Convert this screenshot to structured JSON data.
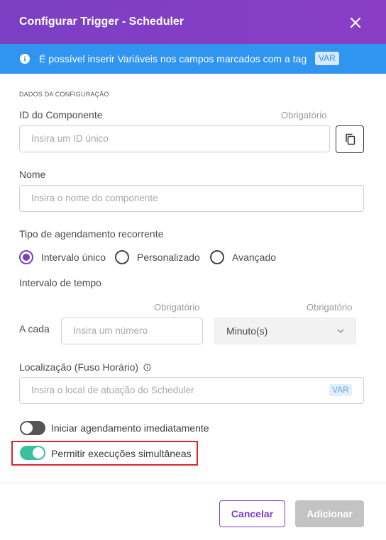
{
  "header": {
    "title": "Configurar Trigger - Scheduler",
    "close_icon": "close-icon"
  },
  "info_banner": {
    "icon": "info-icon",
    "text": "É possível inserir Variáveis nos campos marcados com a tag",
    "tag": "VAR"
  },
  "section": {
    "label": "DADOS DA CONFIGURAÇÃO"
  },
  "component_id": {
    "label": "ID do Componente",
    "required": "Obrigatório",
    "placeholder": "Insira um ID único",
    "copy_icon": "copy-icon"
  },
  "name": {
    "label": "Nome",
    "placeholder": "Insira o nome do componente"
  },
  "schedule_type": {
    "label": "Tipo de agendamento recorrente",
    "options": [
      {
        "label": "Intervalo único",
        "selected": true
      },
      {
        "label": "Personalizado",
        "selected": false
      },
      {
        "label": "Avançado",
        "selected": false
      }
    ]
  },
  "interval": {
    "label": "Intervalo de tempo",
    "every_label": "A cada",
    "number_required": "Obrigatório",
    "number_placeholder": "Insira um número",
    "unit_required": "Obrigatório",
    "unit_value": "Minuto(s)"
  },
  "location": {
    "label": "Localização (Fuso Horário)",
    "info_icon": "info-circle-icon",
    "placeholder": "Insira o local de atuação do Scheduler",
    "tag": "VAR"
  },
  "toggles": [
    {
      "label": "Iniciar agendamento imediatamente",
      "on": false
    },
    {
      "label": "Permitir execuções simultâneas",
      "on": true
    }
  ],
  "colors": {
    "header_purple": "#7b3fc4",
    "info_blue": "#2f95f0",
    "toggle_on": "#3bbf9c",
    "highlight_red": "#d8262f"
  },
  "footer": {
    "cancel": "Cancelar",
    "add": "Adicionar"
  }
}
